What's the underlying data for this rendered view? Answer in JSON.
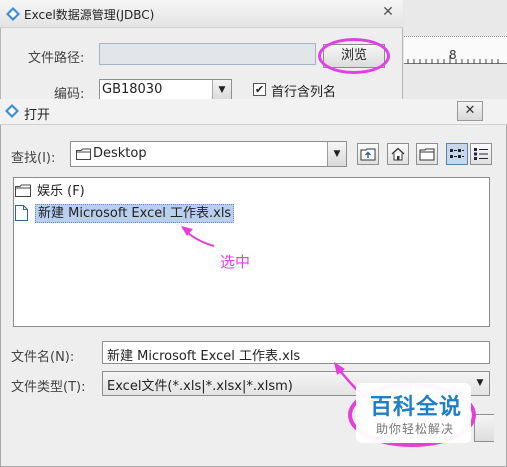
{
  "bg_dialog": {
    "title": "Excel数据源管理(JDBC)",
    "close_symbol": "✕",
    "path_label": "文件路径:",
    "path_value": "",
    "browse_label": "浏览",
    "encoding_label": "编码:",
    "encoding_value": "GB18030",
    "first_row_label": "首行含列名",
    "first_row_checked_symbol": "✔"
  },
  "ruler": {
    "number": "8"
  },
  "open_dialog": {
    "title": "打开",
    "close_symbol": "✕",
    "lookin_label": "查找(I):",
    "lookin_value": "Desktop",
    "files": [
      {
        "name": "娱乐 (F)",
        "type": "folder"
      },
      {
        "name": "新建 Microsoft Excel 工作表.xls",
        "type": "file"
      }
    ],
    "filename_label": "文件名(N):",
    "filename_value": "新建 Microsoft Excel 工作表.xls",
    "filetype_label": "文件类型(T):",
    "filetype_value": "Excel文件(*.xls|*.xlsx|*.xlsm)"
  },
  "annotation": {
    "hint": "选中",
    "color": "#e43fd8"
  },
  "watermark": {
    "main": "百科全说",
    "sub": "助你轻松解决"
  },
  "icons": {
    "app": "app-icon",
    "folder": "folder-icon",
    "file": "file-icon",
    "dropdown": "chevron-down-icon",
    "up": "up-one-level-icon",
    "home": "home-icon",
    "new_folder": "new-folder-icon",
    "list": "list-view-icon",
    "details": "details-view-icon"
  }
}
